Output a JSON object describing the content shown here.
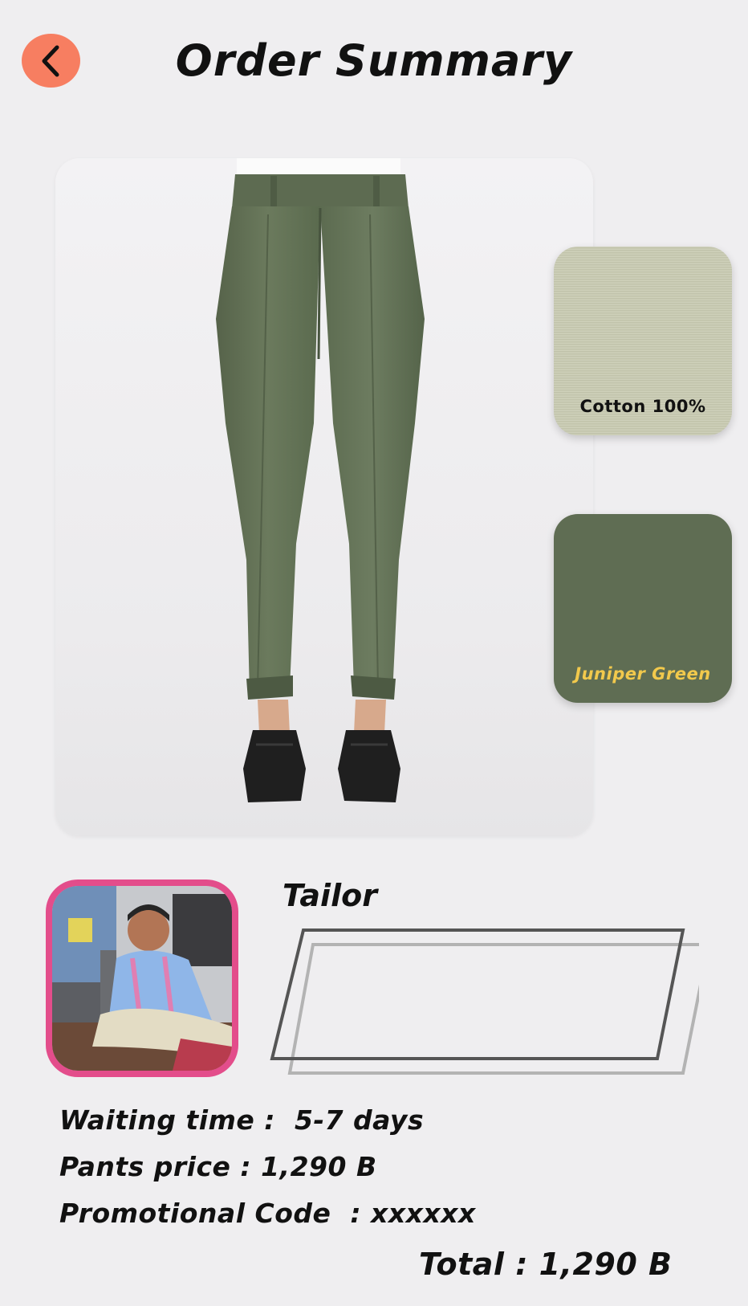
{
  "header": {
    "title": "Order Summary",
    "back_icon": "chevron-left-icon",
    "accent_color": "#f77e61"
  },
  "product": {
    "image_subject": "green pleated trousers with black loafers"
  },
  "options": {
    "fabric_label": "Cotton 100%",
    "fabric_color": "#c9cbb2",
    "color_label": "Juniper Green",
    "color_value": "#5f6d53",
    "color_label_color": "#f2c94c"
  },
  "tailor": {
    "label": "Tailor",
    "input_value": "",
    "frame_color": "#e34d8b"
  },
  "summary": {
    "waiting_time": "Waiting time :  5-7 days",
    "pants_price": "Pants price : 1,290 B",
    "promo_code": "Promotional Code  : xxxxxx",
    "total": "Total : 1,290 B"
  }
}
